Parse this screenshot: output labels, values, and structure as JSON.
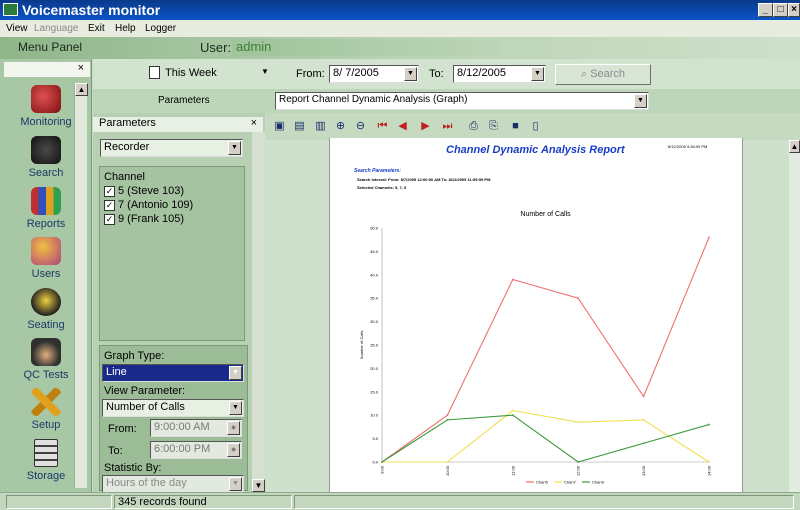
{
  "window": {
    "title": "Voicemaster monitor",
    "min": "_",
    "max": "□",
    "close": "×"
  },
  "menu": {
    "items": [
      "View",
      "Language",
      "Exit",
      "Help",
      "Logger"
    ]
  },
  "header": {
    "menu_panel": "Menu Panel",
    "user_label": "User:",
    "user_value": "admin"
  },
  "left_panel": {
    "close": "×",
    "nav": [
      {
        "label": "Monitoring",
        "icon": "phone-icon"
      },
      {
        "label": "Search",
        "icon": "binoculars-icon"
      },
      {
        "label": "Reports",
        "icon": "reports-icon"
      },
      {
        "label": "Users",
        "icon": "users-icon"
      },
      {
        "label": "Seating",
        "icon": "headset-icon"
      },
      {
        "label": "QC Tests",
        "icon": "inspector-icon"
      },
      {
        "label": "Setup",
        "icon": "tools-icon"
      },
      {
        "label": "Storage",
        "icon": "storage-icon"
      }
    ],
    "colors": {
      "nav_text": "#1a3a6a"
    }
  },
  "toolbar": {
    "period": "This Week",
    "from_label": "From:",
    "from_value": "8/ 7/2005",
    "to_label": "To:",
    "to_value": "8/12/2005",
    "search": "Search"
  },
  "report_bar": {
    "label": "Parameters",
    "report": "Report Channel Dynamic Analysis (Graph)"
  },
  "params": {
    "header": "Parameters",
    "close": "×",
    "source": "Recorder",
    "channel_label": "Channel",
    "channels": [
      {
        "label": "5 (Steve 103)",
        "checked": true
      },
      {
        "label": "7 (Antonio 109)",
        "checked": true
      },
      {
        "label": "9 (Frank 105)",
        "checked": true
      }
    ],
    "graph_type_label": "Graph Type:",
    "graph_type": "Line",
    "view_param_label": "View Parameter:",
    "view_param": "Number of Calls",
    "from_label": "From:",
    "from_time": "9:00:00 AM",
    "to_label": "To:",
    "to_time": "6:00:00 PM",
    "statistic_label": "Statistic By:",
    "statistic": "Hours of the day"
  },
  "report": {
    "title": "Channel Dynamic Analysis Report",
    "date": "8/12/2005 4:36:00 PM",
    "params_heading": "Search Parameters:",
    "params_line1": "Search Interval: From: 8/7/2005 12:00:00 AM To: 8/12/2005 11:59:59 PM",
    "params_line2": "Selected Channels: 5, 7, 9",
    "colors": {
      "title": "#1a3cc8",
      "heading": "#1a3cc8"
    }
  },
  "chart_data": {
    "type": "line",
    "title": "Number of Calls",
    "ylabel": "Number of Calls",
    "xlabel": "",
    "categories": [
      "9:00",
      "10:00",
      "11:00",
      "12:00",
      "13:00",
      "14:00"
    ],
    "ylim": [
      0,
      50
    ],
    "yticks": [
      "0.0",
      "5.0",
      "10.0",
      "15.0",
      "20.0",
      "25.0",
      "30.0",
      "35.0",
      "40.0",
      "45.0",
      "50.0"
    ],
    "series": [
      {
        "name": "Chan5",
        "color": "#f07070",
        "values": [
          0,
          10,
          39,
          35,
          14,
          48
        ]
      },
      {
        "name": "Chan7",
        "color": "#f0e050",
        "values": [
          0,
          0,
          11,
          8.5,
          9,
          0
        ]
      },
      {
        "name": "Chan9",
        "color": "#3c9a3c",
        "values": [
          0,
          9,
          10,
          0,
          4,
          8
        ]
      }
    ]
  },
  "status": {
    "records": "345 records found"
  }
}
